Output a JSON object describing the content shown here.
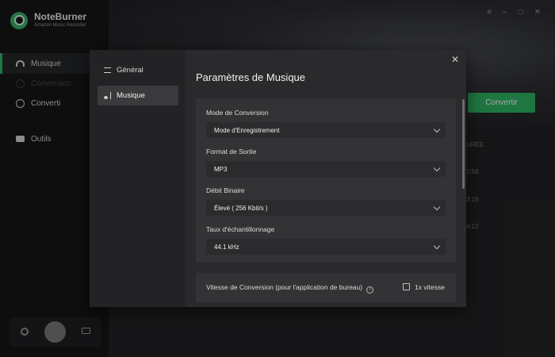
{
  "app": {
    "name": "NoteBurner",
    "subtitle": "Amazon Music Recorder"
  },
  "sidebar": {
    "items": [
      {
        "label": "Musique",
        "icon": "headphones-icon"
      },
      {
        "label": "Conversion",
        "icon": "conversion-icon"
      },
      {
        "label": "Converti",
        "icon": "clock-icon"
      },
      {
        "label": "Outils",
        "icon": "toolbox-icon"
      }
    ]
  },
  "main": {
    "convert_label": "Convertir",
    "partial_header": "URÉE",
    "durations": [
      "2:58",
      "3:19",
      "4:12"
    ]
  },
  "window_controls": [
    "≡",
    "–",
    "□",
    "✕"
  ],
  "settings": {
    "nav": [
      {
        "label": "Général",
        "icon": "sliders-icon"
      },
      {
        "label": "Musique",
        "icon": "music-note-icon"
      }
    ],
    "title": "Paramètres de Musique",
    "close_glyph": "✕",
    "fields": [
      {
        "label": "Mode de Conversion",
        "value": "Mode d'Enregistrement"
      },
      {
        "label": "Format de Sortie",
        "value": "MP3"
      },
      {
        "label": "Débit Binaire",
        "value": "Élevé ( 256 Kbit/s )"
      },
      {
        "label": "Taux d'échantillonnage",
        "value": "44.1 kHz"
      }
    ],
    "speed": {
      "label": "Vitesse de Conversion (pour l'application de bureau)",
      "info_glyph": "i",
      "checkbox_label": "1x vitesse",
      "checked": false
    }
  },
  "colors": {
    "accent": "#2fb565",
    "modal_bg": "#2a2a2c",
    "card_bg": "#333336"
  }
}
